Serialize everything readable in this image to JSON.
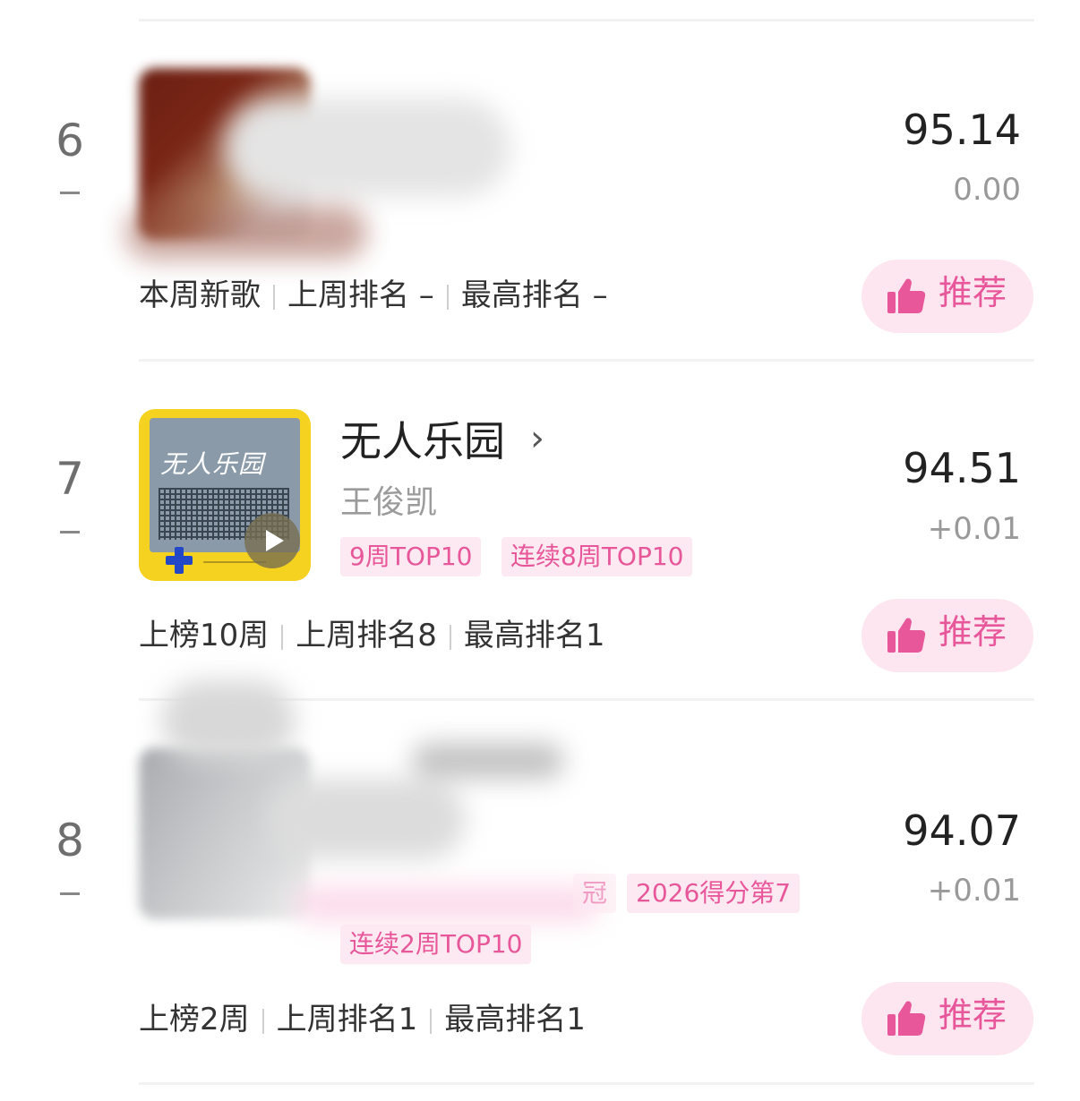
{
  "rows": [
    {
      "rank": "6",
      "score": "95.14",
      "delta": "0.00",
      "meta": [
        "本周新歌",
        "上周排名 –",
        "最高排名 –"
      ],
      "recommend_label": "推荐"
    },
    {
      "rank": "7",
      "title": "无人乐园",
      "artist": "王俊凯",
      "cover_script": "无人乐园",
      "tags": [
        "9周TOP10",
        "连续8周TOP10"
      ],
      "score": "94.51",
      "delta": "+0.01",
      "meta": [
        "上榜10周",
        "上周排名8",
        "最高排名1"
      ],
      "recommend_label": "推荐"
    },
    {
      "rank": "8",
      "tags": [
        "冠",
        "2026得分第7",
        "连续2周TOP10"
      ],
      "score": "94.07",
      "delta": "+0.01",
      "meta": [
        "上榜2周",
        "上周排名1",
        "最高排名1"
      ],
      "recommend_label": "推荐"
    }
  ],
  "icons": {
    "thumb": "thumbs-up-icon",
    "play": "play-icon",
    "chevron": "chevron-right-icon"
  },
  "colors": {
    "accent_pink": "#e8579a",
    "tag_bg": "#fde9f1",
    "button_bg": "#fde6ef"
  }
}
